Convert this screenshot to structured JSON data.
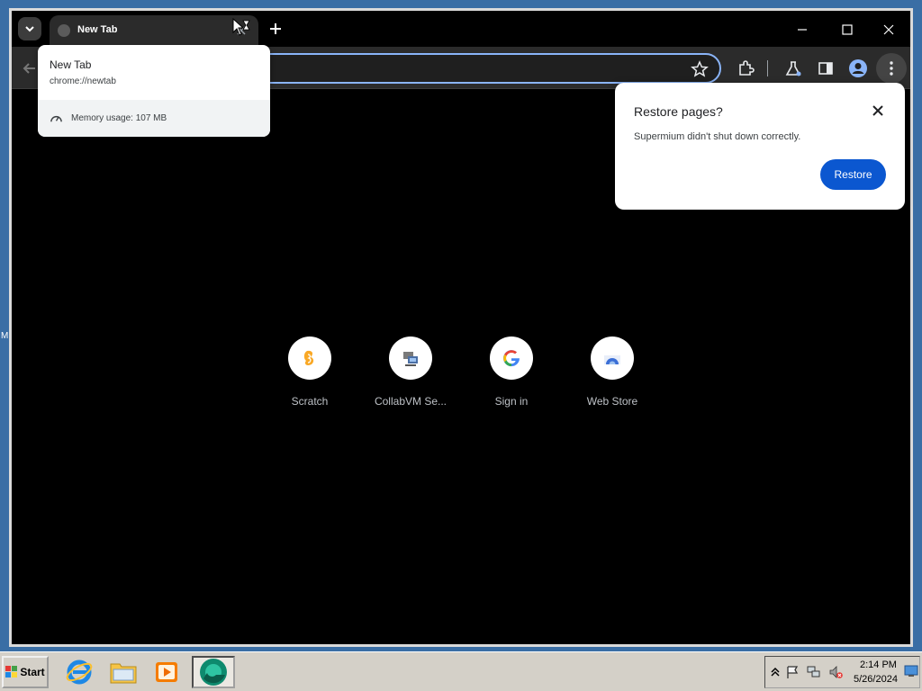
{
  "desktop": {
    "edge_label": "M"
  },
  "browser": {
    "tab": {
      "title": "New Tab"
    },
    "hover_card": {
      "title": "New Tab",
      "url": "chrome://newtab",
      "memory": "Memory usage: 107 MB"
    },
    "restore_dialog": {
      "title": "Restore pages?",
      "message": "Supermium didn't shut down correctly.",
      "button": "Restore"
    },
    "shortcuts": [
      {
        "label": "Scratch",
        "icon": "scratch-icon"
      },
      {
        "label": "CollabVM Se...",
        "icon": "collabvm-icon"
      },
      {
        "label": "Sign in",
        "icon": "google-icon"
      },
      {
        "label": "Web Store",
        "icon": "web-store-icon"
      }
    ]
  },
  "taskbar": {
    "start_label": "Start",
    "clock_time": "2:14 PM",
    "clock_date": "5/26/2024"
  },
  "colors": {
    "desktop": "#3a6ea5",
    "accent_blue": "#0b57d0",
    "omnibox_focus": "#8ab4f8"
  }
}
